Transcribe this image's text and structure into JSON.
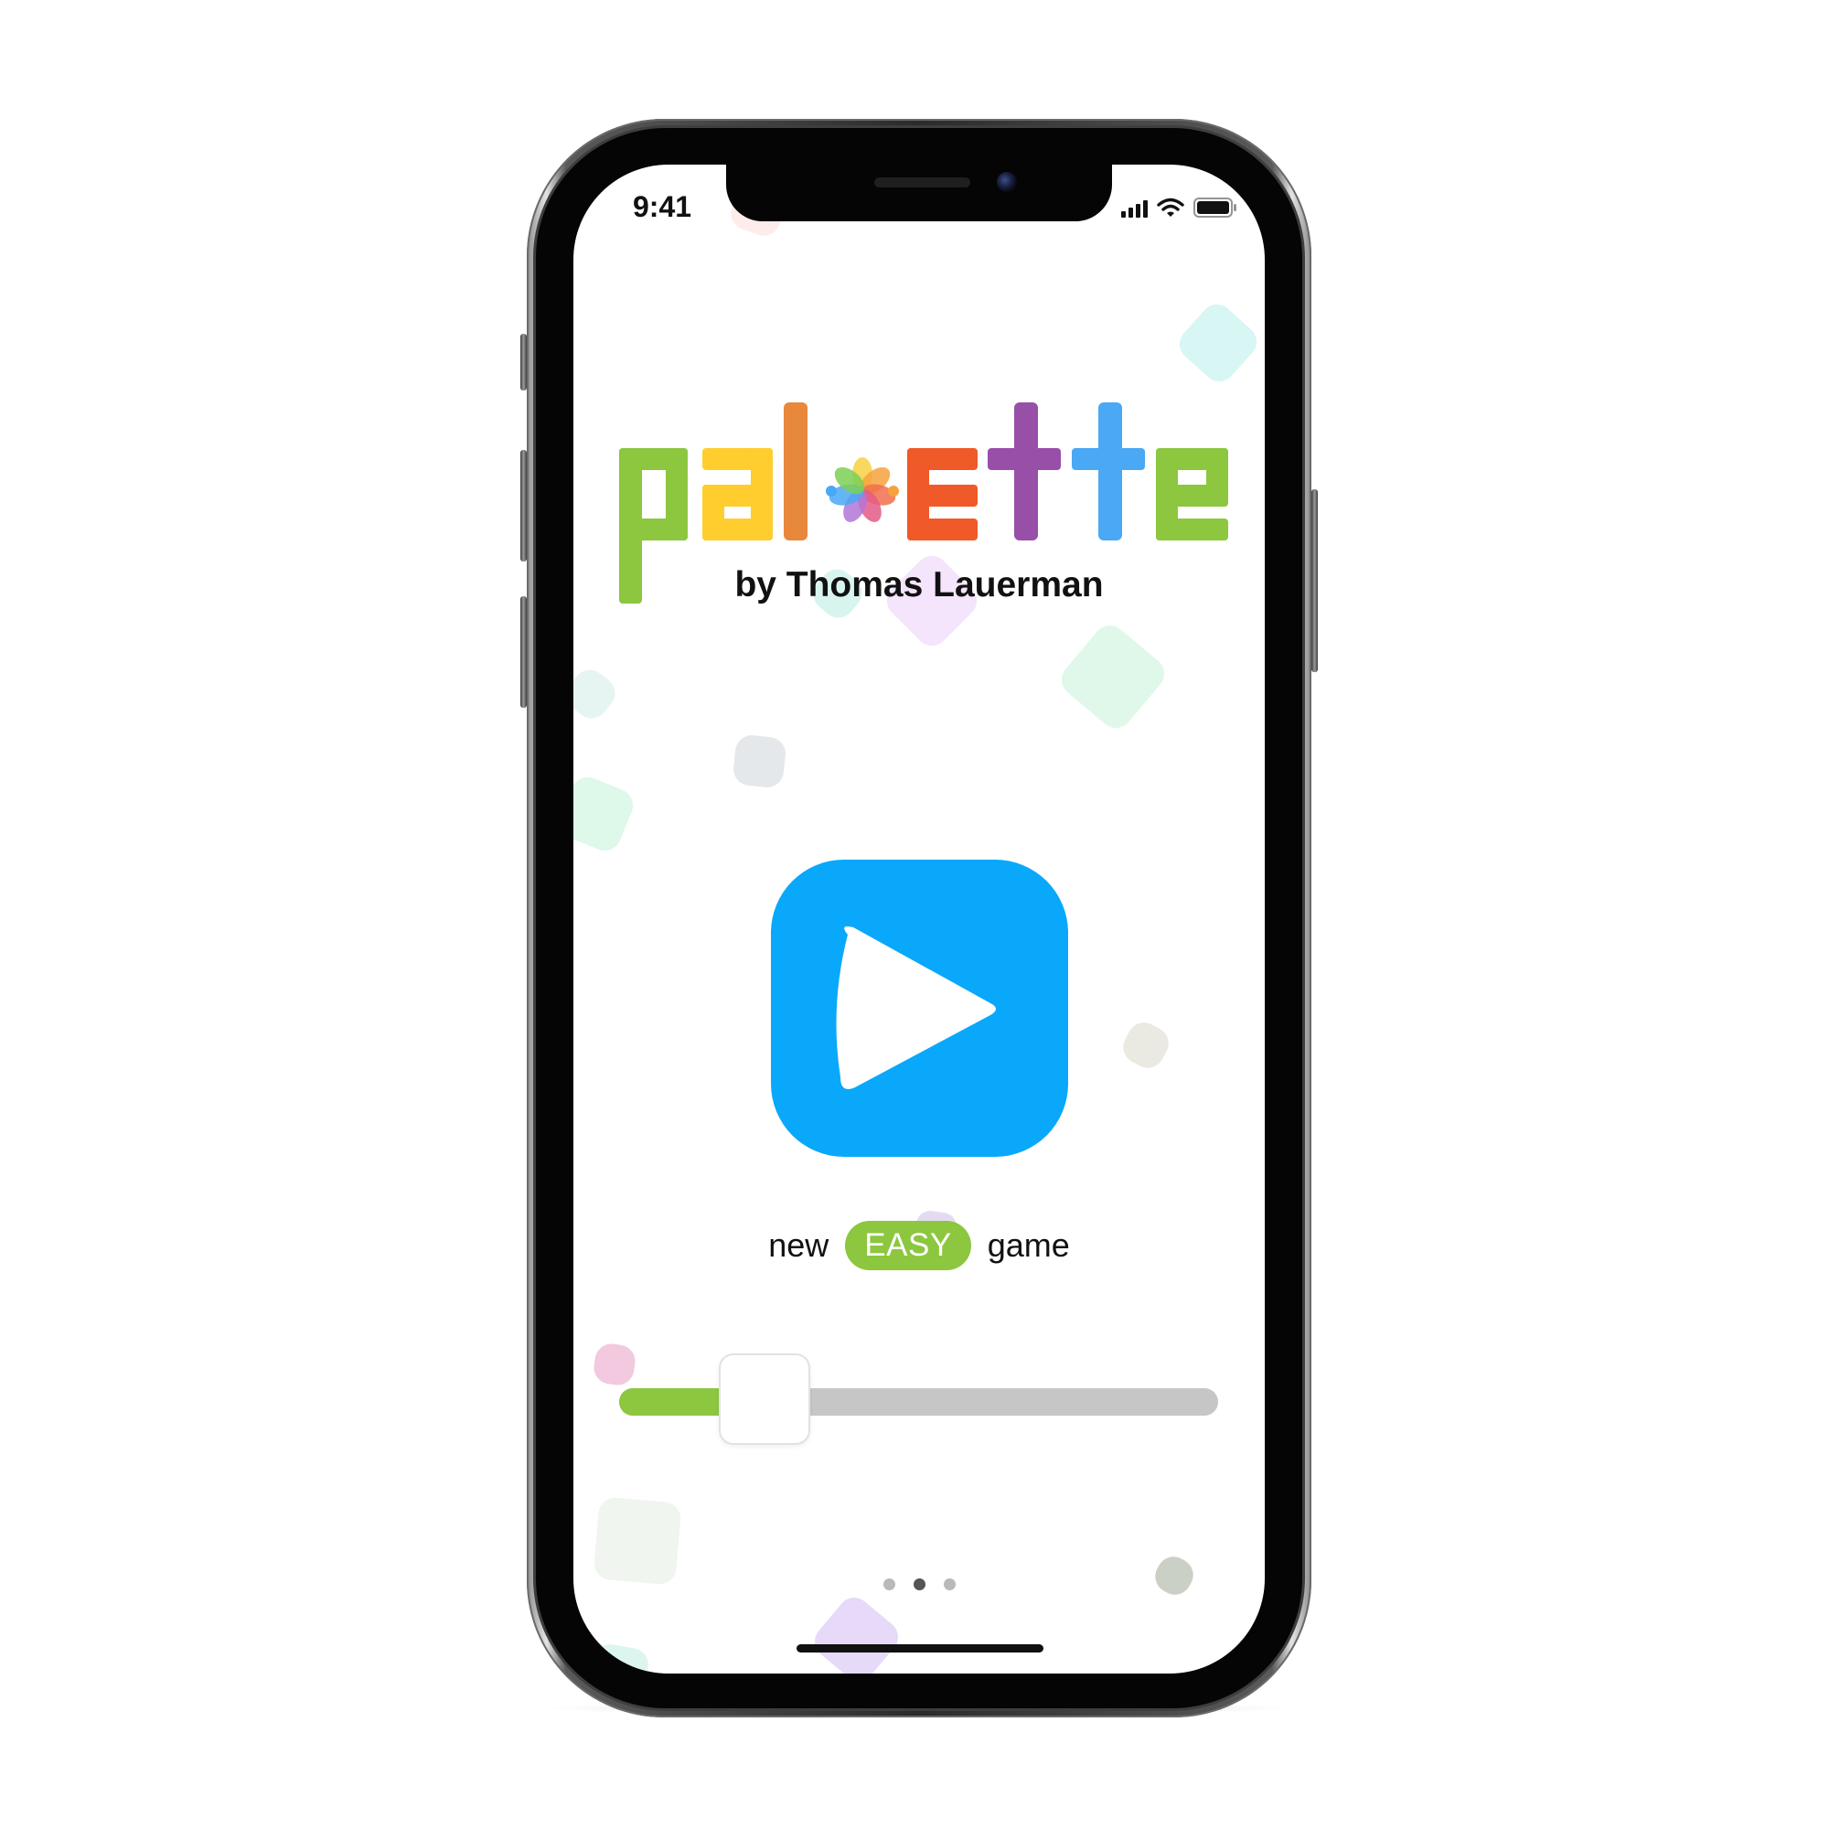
{
  "status_bar": {
    "time": "9:41",
    "icons": [
      "cellular-signal-icon",
      "wifi-icon",
      "battery-icon"
    ]
  },
  "title_logo": {
    "letters": [
      {
        "glyph": "p",
        "color": "#8dc63f"
      },
      {
        "glyph": "a",
        "color": "#ffcd2e"
      },
      {
        "glyph": "l",
        "color": "#e8883d"
      },
      {
        "glyph": "palette-flower-icon",
        "color": "multicolor"
      },
      {
        "glyph": "e",
        "color": "#f05a28"
      },
      {
        "glyph": "t",
        "color": "#984fa8"
      },
      {
        "glyph": "t",
        "color": "#4aa8f5"
      },
      {
        "glyph": "e",
        "color": "#8dc63f"
      }
    ]
  },
  "byline": "by Thomas Lauerman",
  "play_button": {
    "icon": "play-icon",
    "color": "#0aa8fa"
  },
  "mode": {
    "prefix": "new",
    "difficulty": "EASY",
    "suffix": "game",
    "badge_color": "#8dc63f"
  },
  "difficulty_slider": {
    "value_fraction": 0.2,
    "fill_color": "#8dc63f",
    "track_color": "#c6c6c6"
  },
  "pagination": {
    "pages": 3,
    "active_page": 2
  }
}
